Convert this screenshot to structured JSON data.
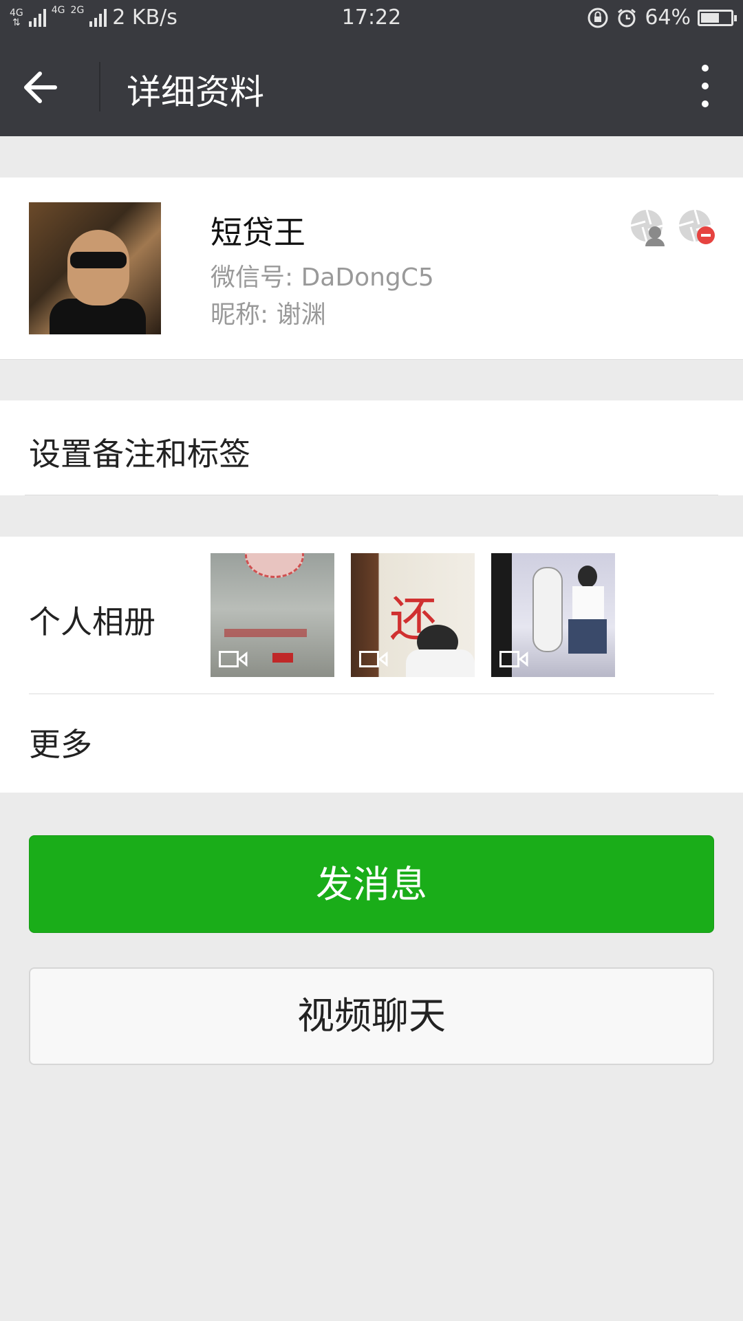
{
  "status_bar": {
    "network_label_1": "4G",
    "network_label_2": "4G",
    "network_label_3": "2G",
    "speed": "2 KB/s",
    "time": "17:22",
    "battery": "64%",
    "battery_level": 0.64
  },
  "header": {
    "title": "详细资料",
    "back_icon": "arrow-left-icon",
    "menu_icon": "more-vertical-icon"
  },
  "profile": {
    "name": "短贷王",
    "wechat_id": "微信号: DaDongC5",
    "nickname": "昵称: 谢渊"
  },
  "remark": {
    "label": "设置备注和标签"
  },
  "album": {
    "label": "个人相册",
    "items": [
      {
        "type": "video",
        "icon": "video-icon"
      },
      {
        "type": "video",
        "icon": "video-icon"
      },
      {
        "type": "video",
        "icon": "video-icon"
      }
    ],
    "more_label": "更多"
  },
  "actions": {
    "message_label": "发消息",
    "video_call_label": "视频聊天"
  },
  "colors": {
    "header_bg": "#393a3f",
    "primary_green": "#1aad19",
    "page_bg": "#ebebeb"
  }
}
